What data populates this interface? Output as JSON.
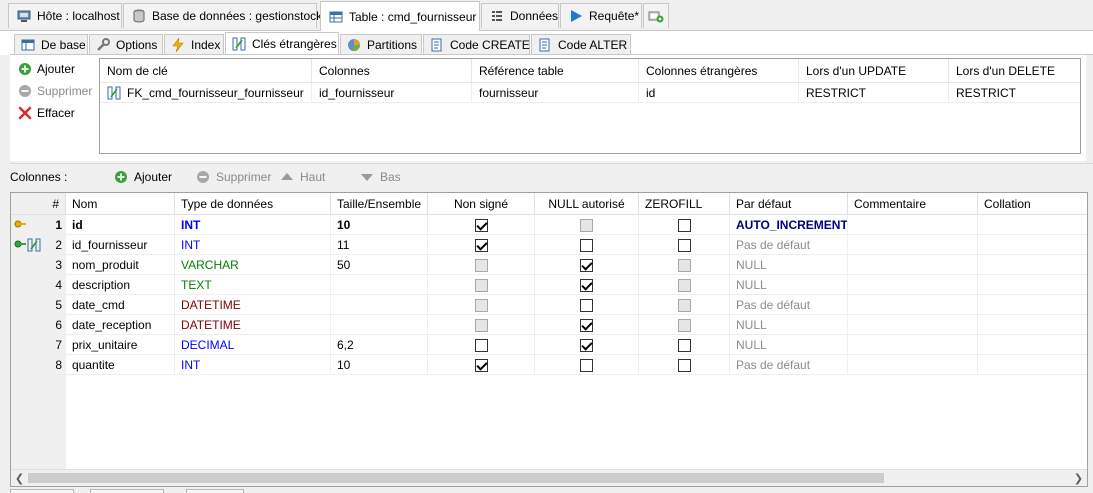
{
  "top_tabs": [
    {
      "label": "Hôte : localhost",
      "icon": "host-icon"
    },
    {
      "label": "Base de données : gestionstock",
      "icon": "database-icon"
    },
    {
      "label": "Table : cmd_fournisseur",
      "icon": "table-icon"
    },
    {
      "label": "Données",
      "icon": "data-grid-icon"
    },
    {
      "label": "Requête*",
      "icon": "play-icon"
    },
    {
      "label": "",
      "icon": "new-query-icon"
    }
  ],
  "sub_tabs": [
    {
      "label": "De base",
      "icon": "table-basic-icon"
    },
    {
      "label": "Options",
      "icon": "wrench-icon"
    },
    {
      "label": "Index",
      "icon": "lightning-icon"
    },
    {
      "label": "Clés étrangères",
      "icon": "foreign-key-icon"
    },
    {
      "label": "Partitions",
      "icon": "partitions-icon"
    },
    {
      "label": "Code CREATE",
      "icon": "code-icon"
    },
    {
      "label": "Code ALTER",
      "icon": "code-icon"
    }
  ],
  "fk_buttons": {
    "add": "Ajouter",
    "remove": "Supprimer",
    "clear": "Effacer"
  },
  "fk_table": {
    "headers": [
      "Nom de clé",
      "Colonnes",
      "Référence table",
      "Colonnes étrangères",
      "Lors d'un UPDATE",
      "Lors d'un DELETE"
    ],
    "rows": [
      [
        "FK_cmd_fournisseur_fournisseur",
        "id_fournisseur",
        "fournisseur",
        "id",
        "RESTRICT",
        "RESTRICT"
      ]
    ]
  },
  "columns_toolbar": {
    "label": "Colonnes :",
    "add": "Ajouter",
    "remove": "Supprimer",
    "up": "Haut",
    "down": "Bas"
  },
  "columns_table": {
    "headers": [
      "#",
      "Nom",
      "Type de données",
      "Taille/Ensemble",
      "Non signé",
      "NULL autorisé",
      "ZEROFILL",
      "Par défaut",
      "Commentaire",
      "Collation"
    ],
    "rows": [
      {
        "num": "1",
        "name": "id",
        "type": "INT",
        "size": "10",
        "unsigned": "checked",
        "null": "disabled",
        "zerofill": "unchecked",
        "default": "AUTO_INCREMENT",
        "comment": "",
        "collation": "",
        "key": "primary"
      },
      {
        "num": "2",
        "name": "id_fournisseur",
        "type": "INT",
        "size": "11",
        "unsigned": "checked",
        "null": "unchecked",
        "zerofill": "unchecked",
        "default": "Pas de défaut",
        "comment": "",
        "collation": "",
        "key": "foreign"
      },
      {
        "num": "3",
        "name": "nom_produit",
        "type": "VARCHAR",
        "size": "50",
        "unsigned": "disabled",
        "null": "checked",
        "zerofill": "disabled",
        "default": "NULL",
        "comment": "",
        "collation": "",
        "key": ""
      },
      {
        "num": "4",
        "name": "description",
        "type": "TEXT",
        "size": "",
        "unsigned": "disabled",
        "null": "checked",
        "zerofill": "disabled",
        "default": "NULL",
        "comment": "",
        "collation": "",
        "key": ""
      },
      {
        "num": "5",
        "name": "date_cmd",
        "type": "DATETIME",
        "size": "",
        "unsigned": "disabled",
        "null": "unchecked",
        "zerofill": "disabled",
        "default": "Pas de défaut",
        "comment": "",
        "collation": "",
        "key": ""
      },
      {
        "num": "6",
        "name": "date_reception",
        "type": "DATETIME",
        "size": "",
        "unsigned": "disabled",
        "null": "checked",
        "zerofill": "disabled",
        "default": "NULL",
        "comment": "",
        "collation": "",
        "key": ""
      },
      {
        "num": "7",
        "name": "prix_unitaire",
        "type": "DECIMAL",
        "size": "6,2",
        "unsigned": "unchecked",
        "null": "checked",
        "zerofill": "unchecked",
        "default": "NULL",
        "comment": "",
        "collation": "",
        "key": ""
      },
      {
        "num": "8",
        "name": "quantite",
        "type": "INT",
        "size": "10",
        "unsigned": "checked",
        "null": "unchecked",
        "zerofill": "unchecked",
        "default": "Pas de défaut",
        "comment": "",
        "collation": "",
        "key": ""
      }
    ]
  },
  "colors": {
    "int": "#0000ff",
    "varchar": "#008000",
    "datetime": "#800000",
    "accent": "#000080"
  }
}
